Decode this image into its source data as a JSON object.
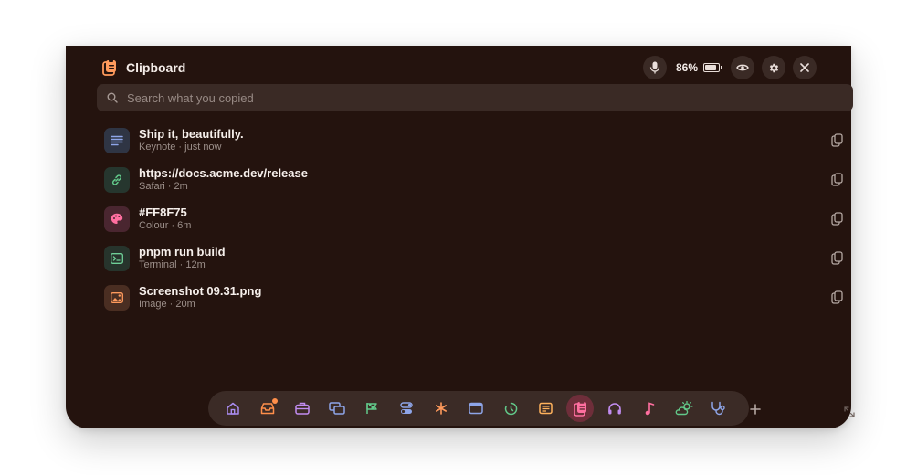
{
  "app": {
    "title": "Clipboard"
  },
  "status": {
    "battery": "86%"
  },
  "search": {
    "placeholder": "Search what you copied",
    "value": ""
  },
  "items": [
    {
      "title": "Ship it, beautifully.",
      "source": "Keynote · just now",
      "icon": "text-lines-icon",
      "icon_bg": "#2f3544",
      "icon_color": "#8ea5e8"
    },
    {
      "title": "https://docs.acme.dev/release",
      "source": "Safari · 2m",
      "icon": "link-icon",
      "icon_bg": "#26362e",
      "icon_color": "#62c98a"
    },
    {
      "title": "#FF8F75",
      "source": "Colour · 6m",
      "icon": "palette-icon",
      "icon_bg": "#4a2630",
      "icon_color": "#ff6fa0"
    },
    {
      "title": "pnpm run build",
      "source": "Terminal · 12m",
      "icon": "terminal-icon",
      "icon_bg": "#27342c",
      "icon_color": "#6fcf97"
    },
    {
      "title": "Screenshot 09.31.png",
      "source": "Image · 20m",
      "icon": "image-icon",
      "icon_bg": "#4a2e22",
      "icon_color": "#ff9a5c"
    }
  ],
  "dock": [
    {
      "icon": "home-icon",
      "color": "#a98cf0"
    },
    {
      "icon": "inbox-icon",
      "color": "#ff8f4a",
      "badge": true
    },
    {
      "icon": "briefcase-icon",
      "color": "#c18cf0"
    },
    {
      "icon": "windows-icon",
      "color": "#8ea5e8"
    },
    {
      "icon": "flag-icon",
      "color": "#62c98a"
    },
    {
      "icon": "toggles-icon",
      "color": "#8ea5e8"
    },
    {
      "icon": "asterisk-icon",
      "color": "#ff9a5c"
    },
    {
      "icon": "browser-window-icon",
      "color": "#8ea5e8"
    },
    {
      "icon": "timer-icon",
      "color": "#62c98a"
    },
    {
      "icon": "note-icon",
      "color": "#ffb25c"
    },
    {
      "icon": "clipboard-icon",
      "color": "#ff6fa0",
      "active": true
    },
    {
      "icon": "headphones-icon",
      "color": "#c18cf0"
    },
    {
      "icon": "music-note-icon",
      "color": "#ff6fa0"
    },
    {
      "icon": "weather-icon",
      "color": "#62c98a"
    },
    {
      "icon": "stethoscope-icon",
      "color": "#8ea5e8"
    }
  ],
  "colors": {
    "background": "#24130e",
    "surface": "#3a2a25",
    "accent": "#ff8f4a"
  }
}
